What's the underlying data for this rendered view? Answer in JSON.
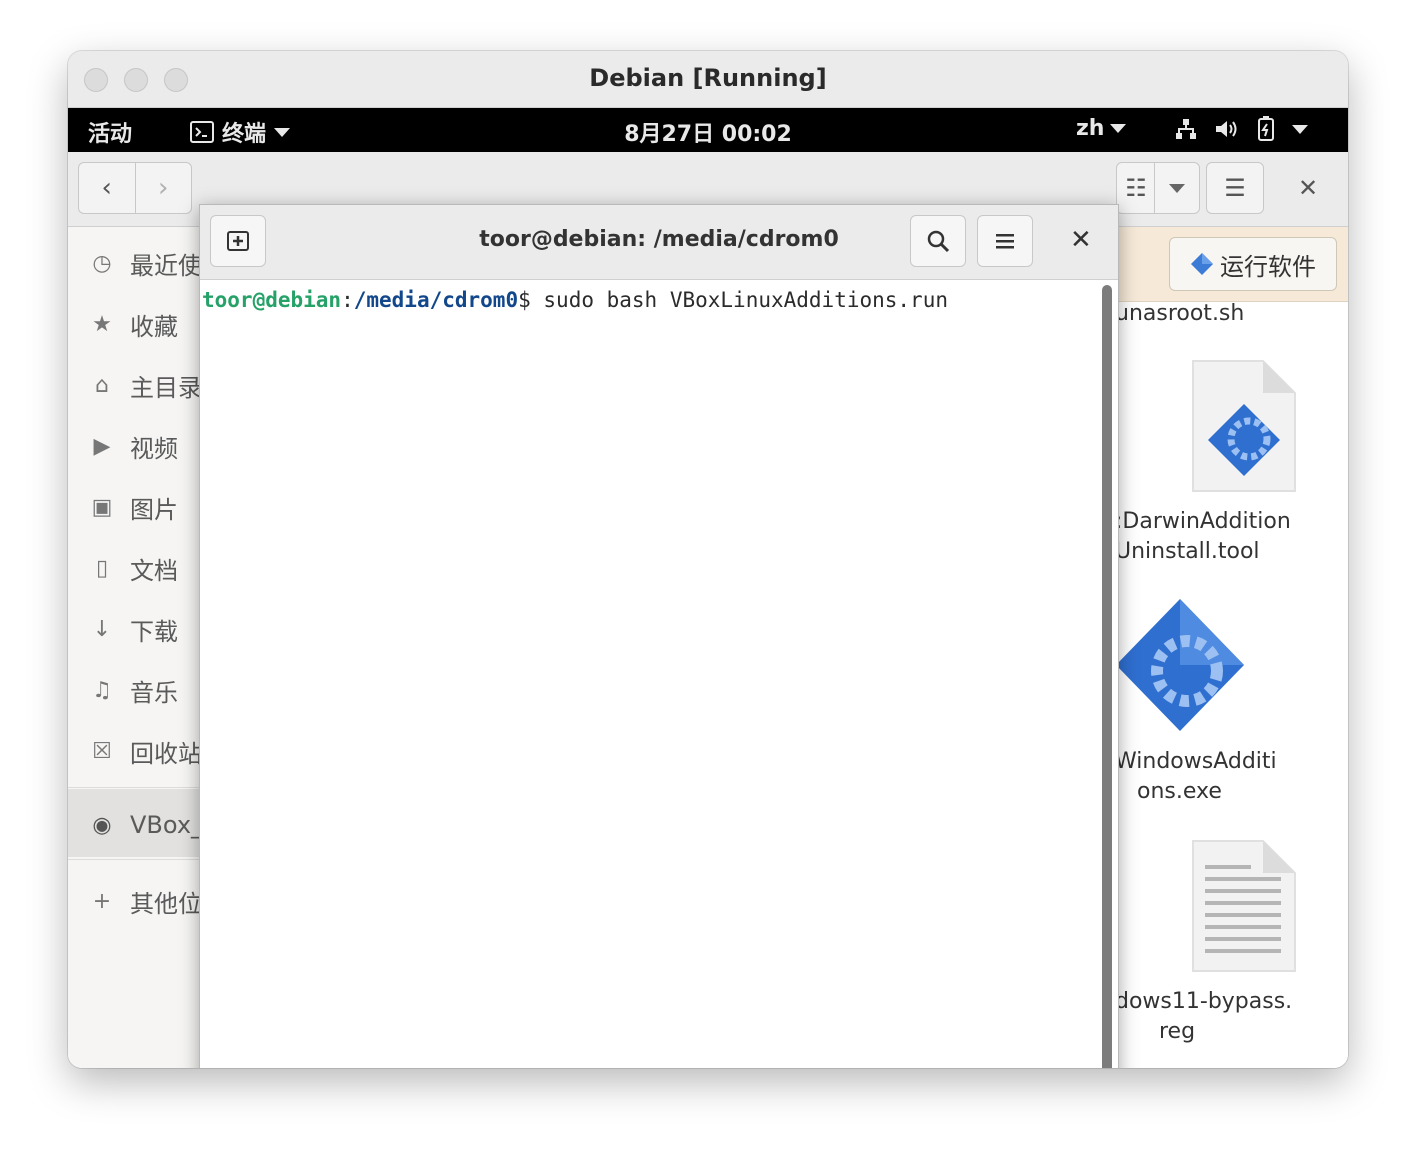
{
  "window": {
    "title": "Debian [Running]"
  },
  "topbar": {
    "activities": "活动",
    "app_name": "终端",
    "clock": "8月27日  00:02",
    "lang": "zh"
  },
  "files": {
    "sidebar": {
      "items": [
        {
          "label": "最近使",
          "icon": "clock-icon"
        },
        {
          "label": "收藏",
          "icon": "star-icon"
        },
        {
          "label": "主目录",
          "icon": "home-icon"
        },
        {
          "label": "视频",
          "icon": "video-icon"
        },
        {
          "label": "图片",
          "icon": "camera-icon"
        },
        {
          "label": "文档",
          "icon": "document-icon"
        },
        {
          "label": "下载",
          "icon": "download-icon"
        },
        {
          "label": "音乐",
          "icon": "music-icon"
        },
        {
          "label": "回收站",
          "icon": "trash-icon"
        }
      ],
      "device": "VBox_",
      "other": "其他位"
    },
    "run_button": "运行软件",
    "file_items": [
      {
        "line1": "unasroot.sh",
        "line2": ""
      },
      {
        "line1": ":DarwinAddition",
        "line2": "Uninstall.tool"
      },
      {
        "line1": "WindowsAdditi",
        "line2": "ons.exe"
      },
      {
        "line1": "dows11-bypass.",
        "line2": "reg"
      }
    ]
  },
  "terminal": {
    "title": "toor@debian: /media/cdrom0",
    "prompt_user": "toor@debian",
    "prompt_sep": ":",
    "prompt_path": "/media/cdrom0",
    "prompt_end": "$ ",
    "command": "sudo bash VBoxLinuxAdditions.run"
  },
  "colors": {
    "prompt_user": "#26a269",
    "prompt_path": "#12488b",
    "run_icon": "#3c7bd6"
  }
}
